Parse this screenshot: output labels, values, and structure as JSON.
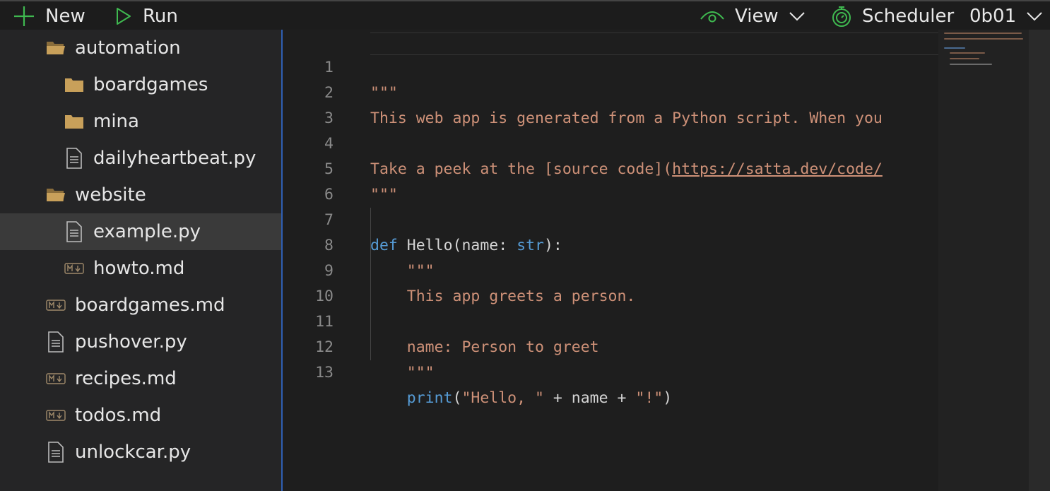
{
  "toolbar": {
    "new_label": "New",
    "run_label": "Run",
    "view_label": "View",
    "scheduler_label": "Scheduler",
    "branch_label": "0b01"
  },
  "sidebar": {
    "items": [
      {
        "label": "automation",
        "icon": "open-folder-icon"
      },
      {
        "label": "boardgames",
        "icon": "folder-icon"
      },
      {
        "label": "mina",
        "icon": "folder-icon"
      },
      {
        "label": "dailyheartbeat.py",
        "icon": "file-icon"
      },
      {
        "label": "website",
        "icon": "open-folder-icon"
      },
      {
        "label": "example.py",
        "icon": "file-icon"
      },
      {
        "label": "howto.md",
        "icon": "markdown-icon"
      },
      {
        "label": "boardgames.md",
        "icon": "markdown-icon"
      },
      {
        "label": "pushover.py",
        "icon": "file-icon"
      },
      {
        "label": "recipes.md",
        "icon": "markdown-icon"
      },
      {
        "label": "todos.md",
        "icon": "markdown-icon"
      },
      {
        "label": "unlockcar.py",
        "icon": "file-icon"
      }
    ]
  },
  "editor": {
    "lines": [
      {
        "n": "1",
        "text": "\"\"\""
      },
      {
        "n": "2",
        "text": "This web app is generated from a Python script. When you"
      },
      {
        "n": "3",
        "text": ""
      },
      {
        "n": "4",
        "text_a": "Take a peek at the [source code](",
        "text_b": "https://satta.dev/code/"
      },
      {
        "n": "5",
        "text": "\"\"\""
      },
      {
        "n": "6",
        "text": ""
      },
      {
        "n": "7",
        "def": "def",
        "name": " Hello(name: ",
        "type": "str",
        "end": "):"
      },
      {
        "n": "8",
        "text": "    \"\"\""
      },
      {
        "n": "9",
        "text": "    This app greets a person."
      },
      {
        "n": "10",
        "text": ""
      },
      {
        "n": "11",
        "text": "    name: Person to greet"
      },
      {
        "n": "12",
        "text": "    \"\"\""
      },
      {
        "n": "13",
        "print": "    print",
        "p1": "(",
        "s1": "\"Hello, \"",
        "mid": " + name + ",
        "s2": "\"!\"",
        "p2": ")"
      }
    ]
  },
  "colors": {
    "accent": "#2f5fb3",
    "string": "#ce9178",
    "keyword": "#569cd6",
    "icon_green": "#3fb950",
    "folder": "#c8a05a"
  }
}
